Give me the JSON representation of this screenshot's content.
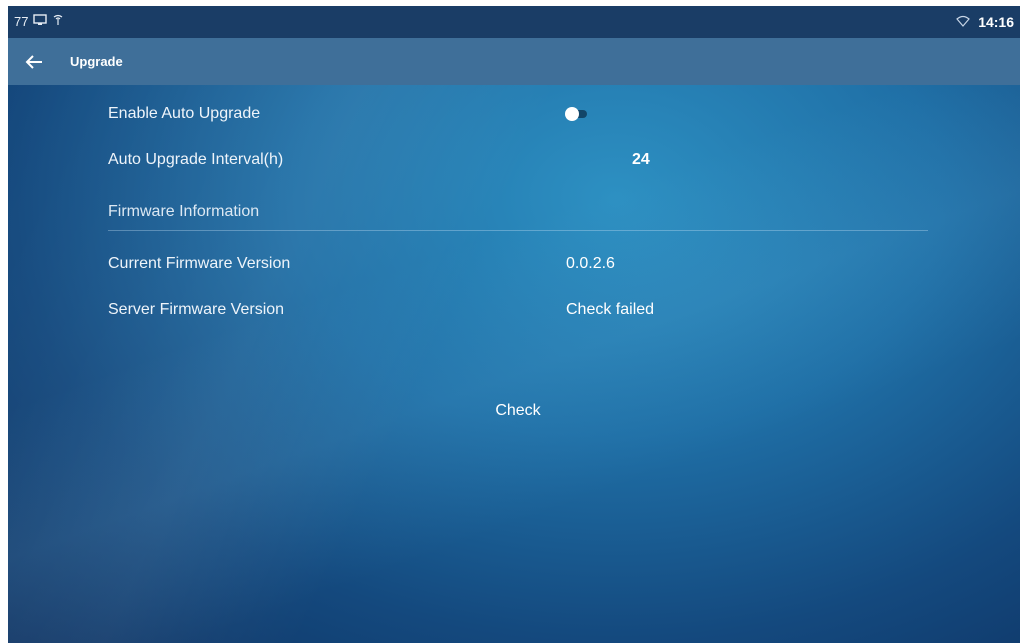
{
  "status_bar": {
    "left_text": "77",
    "icons": [
      "screen-icon",
      "antenna-icon"
    ],
    "right_icons": [
      "wifi-icon"
    ],
    "time": "14:16"
  },
  "title_bar": {
    "back_icon": "arrow-left-icon",
    "title": "Upgrade"
  },
  "settings": {
    "auto_upgrade": {
      "label": "Enable Auto Upgrade",
      "enabled": false
    },
    "interval": {
      "label": "Auto Upgrade Interval(h)",
      "value": "24"
    },
    "firmware_section": "Firmware Information",
    "current_version": {
      "label": "Current Firmware Version",
      "value": "0.0.2.6"
    },
    "server_version": {
      "label": "Server Firmware Version",
      "value": "Check failed"
    }
  },
  "check_button": "Check",
  "colors": {
    "status_bar": "#1a3d66",
    "title_bar": "#3f6f99",
    "background_center": "#2d90c2",
    "background_edge": "#0d3161"
  }
}
